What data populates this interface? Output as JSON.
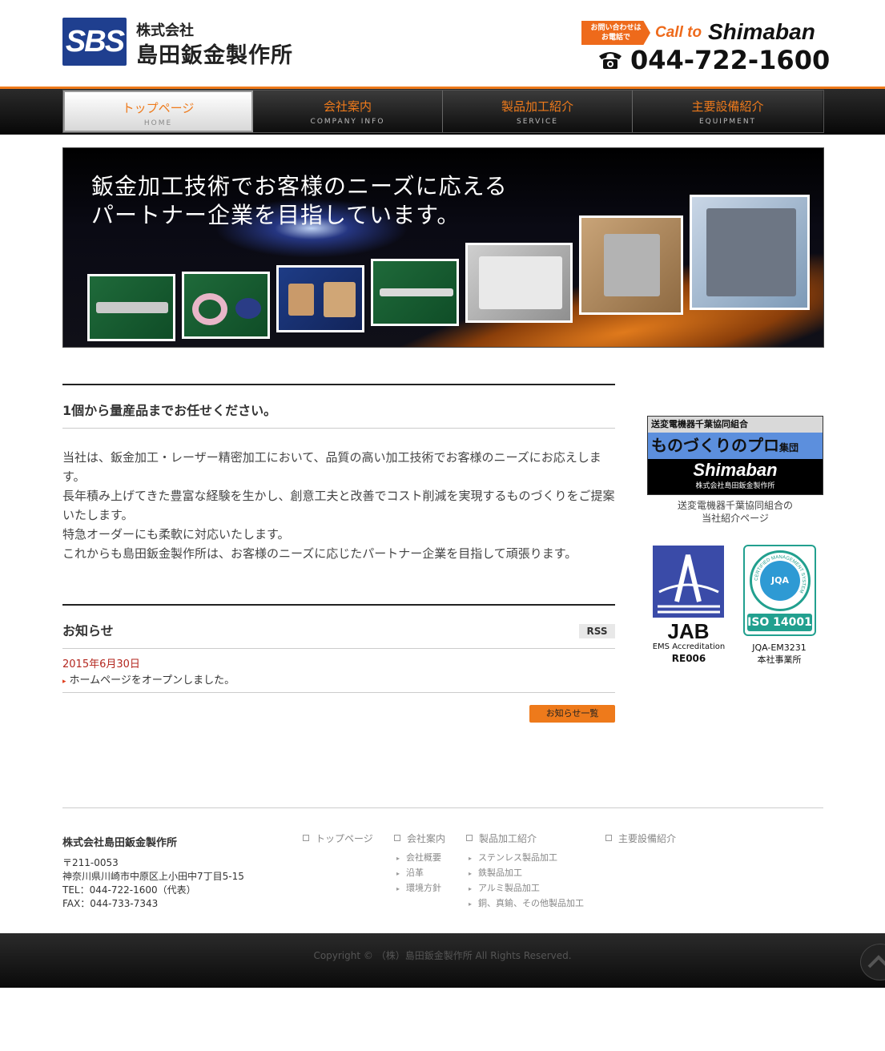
{
  "header": {
    "logo_text": "SBS",
    "company_prefix": "株式会社",
    "company_name": "島田鈑金製作所",
    "call_tag": "お問い合わせは\nお電話で",
    "call_to": "Call to",
    "call_brand": "Shimaban",
    "phone": "044-722-1600",
    "accent_color": "#ee7a1b"
  },
  "nav": [
    {
      "jp": "トップページ",
      "en": "HOME"
    },
    {
      "jp": "会社案内",
      "en": "COMPANY INFO"
    },
    {
      "jp": "製品加工紹介",
      "en": "SERVICE"
    },
    {
      "jp": "主要設備紹介",
      "en": "EQUIPMENT"
    }
  ],
  "hero": {
    "line1": "鈑金加工技術でお客様のニーズに応える",
    "line2": "パートナー企業を目指しています。"
  },
  "intro": {
    "title": "1個から量産品までお任せください。",
    "paragraphs": [
      "当社は、鈑金加工・レーザー精密加工において、品質の高い加工技術でお客様のニーズにお応えします。",
      "長年積み上げてきた豊富な経験を生かし、創意工夫と改善でコスト削減を実現するものづくりをご提案いたします。",
      "特急オーダーにも柔軟に対応いたします。",
      "これからも島田鈑金製作所は、お客様のニーズに応じたパートナー企業を目指して頑張ります。"
    ]
  },
  "news": {
    "title": "お知らせ",
    "rss": "RSS",
    "date": "2015年6月30日",
    "item": "ホームページをオープンしました。",
    "button": "お知らせ一覧"
  },
  "sidebar": {
    "banner_top": "送変電機器千葉協同組合",
    "banner_mid": "ものづくりのプロ",
    "banner_mid_small": "集団",
    "banner_brand": "Shimaban",
    "banner_sub": "株式会社島田鈑金製作所",
    "caption": "送変電機器千葉協同組合の\n当社紹介ページ",
    "jab_word": "JAB",
    "jab_line1": "EMS Accreditation",
    "jab_line2": "RE006",
    "iso_ring": "CERTIFIED MANAGEMENT SYSTEM",
    "iso_inner": "JQA",
    "iso_label": "ISO 14001",
    "iso_line1": "JQA-EM3231",
    "iso_line2": "本社事業所"
  },
  "footer": {
    "name": "株式会社島田鈑金製作所",
    "address": [
      "〒211-0053",
      "神奈川県川崎市中原区上小田中7丁目5-15",
      "TEL：044-722-1600（代表）",
      "FAX：044-733-7343"
    ],
    "nav": {
      "top": "トップページ",
      "company": "会社案内",
      "company_sub": [
        "会社概要",
        "沿革",
        "環境方針"
      ],
      "service": "製品加工紹介",
      "service_sub": [
        "ステンレス製品加工",
        "鉄製品加工",
        "アルミ製品加工",
        "銅、真鍮、その他製品加工"
      ],
      "equipment": "主要設備紹介"
    },
    "copyright": "Copyright © （株）島田鈑金製作所 All Rights Reserved."
  }
}
